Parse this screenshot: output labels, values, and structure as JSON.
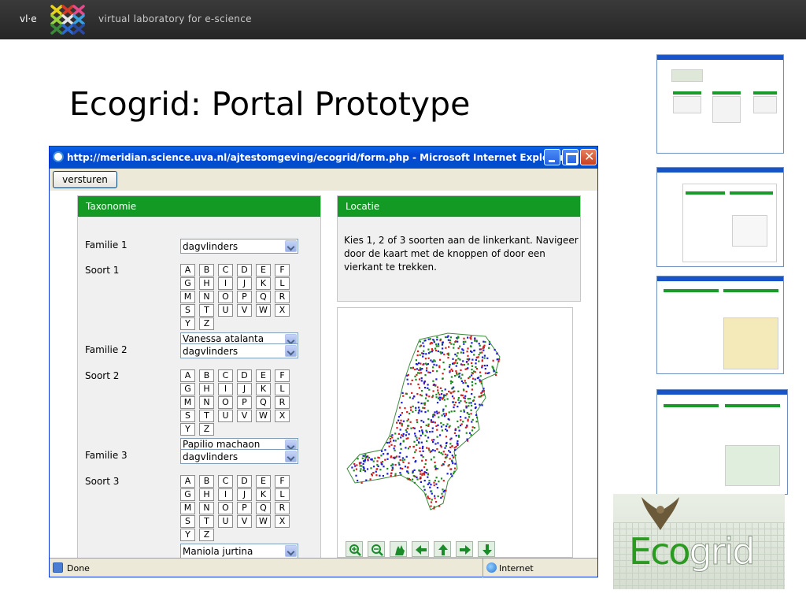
{
  "banner": {
    "vle_label": "vl·e",
    "tagline": "virtual laboratory for e-science"
  },
  "slide_title": "Ecogrid: Portal Prototype",
  "browser": {
    "title": "http://meridian.science.uva.nl/ajtestomgeving/ecogrid/form.php - Microsoft Internet Explorer",
    "submit_label": "versturen",
    "status_text": "Done",
    "zone_text": "Internet"
  },
  "taxonomy": {
    "header": "Taxonomie",
    "letters": [
      "A",
      "B",
      "C",
      "D",
      "E",
      "F",
      "G",
      "H",
      "I",
      "J",
      "K",
      "L",
      "M",
      "N",
      "O",
      "P",
      "Q",
      "R",
      "S",
      "T",
      "U",
      "V",
      "W",
      "X",
      "Y",
      "Z"
    ],
    "families": [
      {
        "family_label": "Familie 1",
        "family_value": "dagvlinders",
        "species_label": "Soort 1",
        "species_value": "Vanessa atalanta"
      },
      {
        "family_label": "Familie 2",
        "family_value": "dagvlinders",
        "species_label": "Soort 2",
        "species_value": "Papilio machaon"
      },
      {
        "family_label": "Familie 3",
        "family_value": "dagvlinders",
        "species_label": "Soort 3",
        "species_value": "Maniola jurtina"
      }
    ]
  },
  "location": {
    "header": "Locatie",
    "instructions": "Kies 1, 2 of 3 soorten aan de linkerkant. Navigeer door de kaart met de knoppen of door een vierkant te trekken."
  },
  "map_nav": [
    "zoom-in-icon",
    "zoom-out-icon",
    "pan-hand-icon",
    "arrow-left-icon",
    "arrow-up-icon",
    "arrow-right-icon",
    "arrow-down-icon"
  ],
  "logo": {
    "word_part1": "Eco",
    "word_part2": "grid"
  },
  "colors": {
    "panel_header": "#129a24",
    "ie_titlebar": "#0347d4"
  }
}
